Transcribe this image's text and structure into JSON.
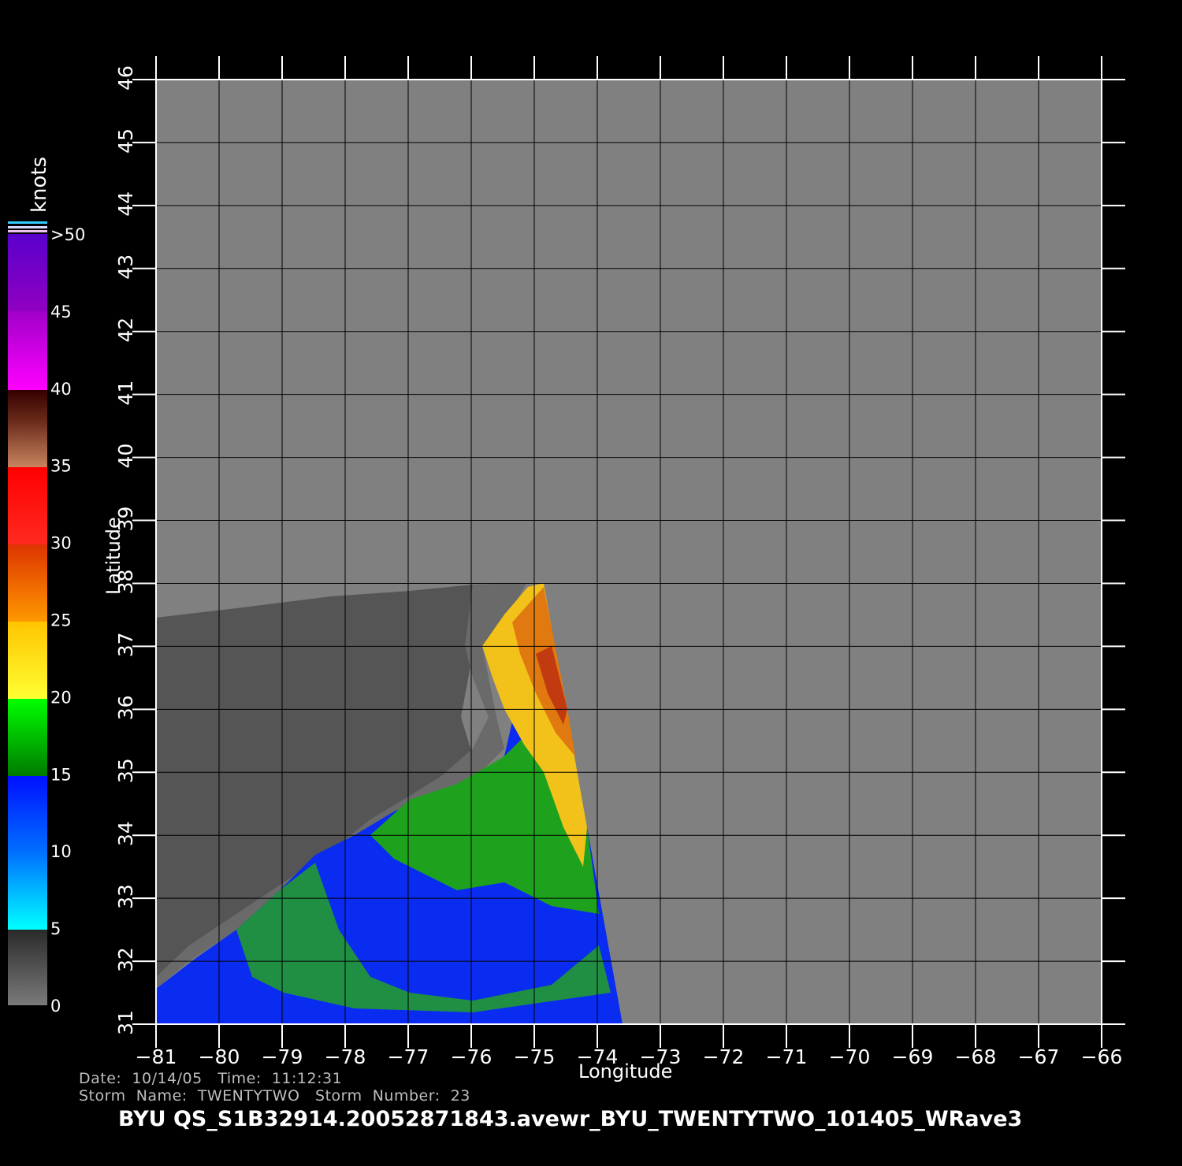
{
  "colorbar": {
    "unit_label": "knots",
    "tick_labels": [
      ">50",
      "45",
      "40",
      "35",
      "30",
      "25",
      "20",
      "15",
      "10",
      "5",
      "0"
    ],
    "colors": {
      "gray_0_5": "#4a4a4a",
      "cyan_5": "#00ffff",
      "blue_10": "#0066ff",
      "blue_15": "#0000ff",
      "green_15": "#00a000",
      "green_20": "#00ff00",
      "yellow_20": "#ffff33",
      "orange_25": "#ff8800",
      "red_30": "#ff2200",
      "red_35": "#ff0000",
      "brown_35": "#c07050",
      "darkred_40": "#400000",
      "magenta_40": "#ff00ff",
      "purple_45": "#a000c0",
      "purple_50": "#6600cc"
    }
  },
  "map": {
    "x_axis_label": "Longitude",
    "y_axis_label": "Latitude",
    "x_ticks": [
      "−81",
      "−80",
      "−79",
      "−78",
      "−77",
      "−76",
      "−75",
      "−74",
      "−73",
      "−72",
      "−71",
      "−70",
      "−69",
      "−68",
      "−67",
      "−66"
    ],
    "y_ticks": [
      "31",
      "32",
      "33",
      "34",
      "35",
      "36",
      "37",
      "38",
      "39",
      "40",
      "41",
      "42",
      "43",
      "44",
      "45",
      "46"
    ],
    "lon_range": [
      -81,
      -66
    ],
    "lat_range": [
      31,
      46
    ],
    "background_color": "#808080",
    "land_color": "#555555"
  },
  "footer": {
    "date_line": "Date:  10/14/05   Time:  11:12:31",
    "storm_line": "Storm  Name:  TWENTYTWO   Storm  Number:  23",
    "title": "BYU  QS_S1B32914.20052871843.avewr_BYU_TWENTYTWO_101405_WRave3"
  }
}
